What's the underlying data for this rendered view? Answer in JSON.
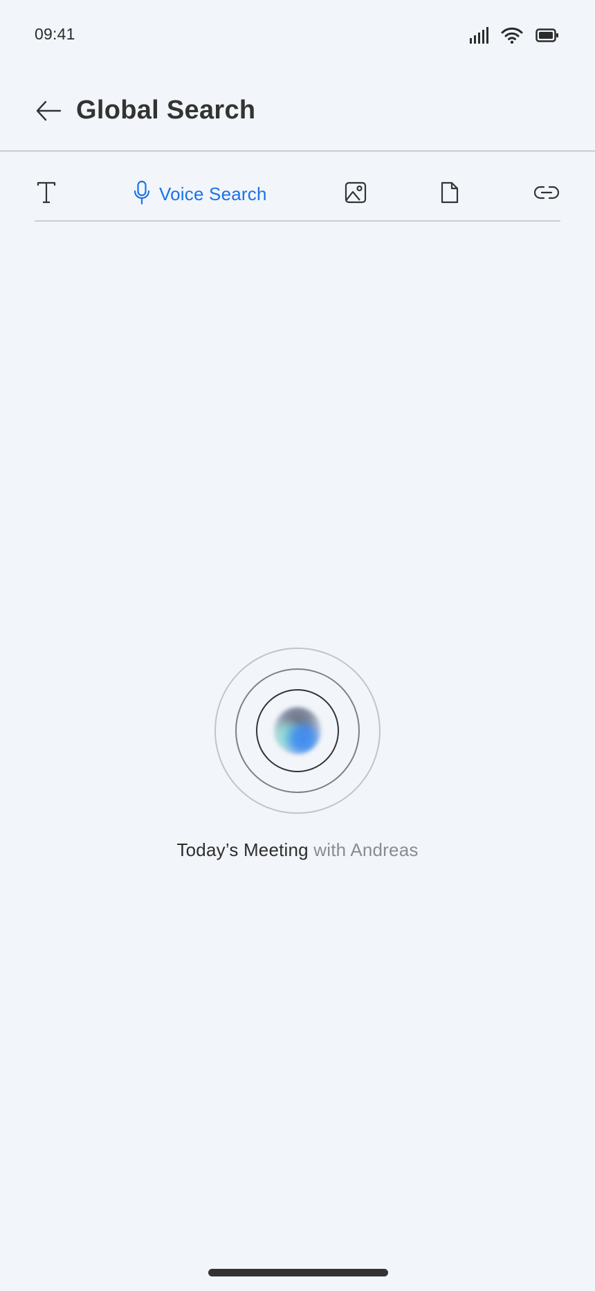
{
  "status_bar": {
    "time": "09:41",
    "icons": [
      "signal-icon",
      "wifi-icon",
      "battery-icon"
    ]
  },
  "header": {
    "back_icon": "arrow-left-icon",
    "title": "Global Search"
  },
  "tabs": [
    {
      "id": "text",
      "icon": "text-icon",
      "label": "",
      "active": false
    },
    {
      "id": "voice",
      "icon": "microphone-icon",
      "label": "Voice Search",
      "active": true
    },
    {
      "id": "image",
      "icon": "image-icon",
      "label": "",
      "active": false
    },
    {
      "id": "file",
      "icon": "file-icon",
      "label": "",
      "active": false
    },
    {
      "id": "link",
      "icon": "link-icon",
      "label": "",
      "active": false
    }
  ],
  "voice": {
    "transcript_recognized": "Today’s Meeting",
    "transcript_pending": "with Andreas"
  },
  "colors": {
    "background": "#f2f5f9",
    "accent": "#1a73e8",
    "text_primary": "#333333",
    "text_muted": "#8a8c90",
    "divider": "#c9ccd1"
  }
}
